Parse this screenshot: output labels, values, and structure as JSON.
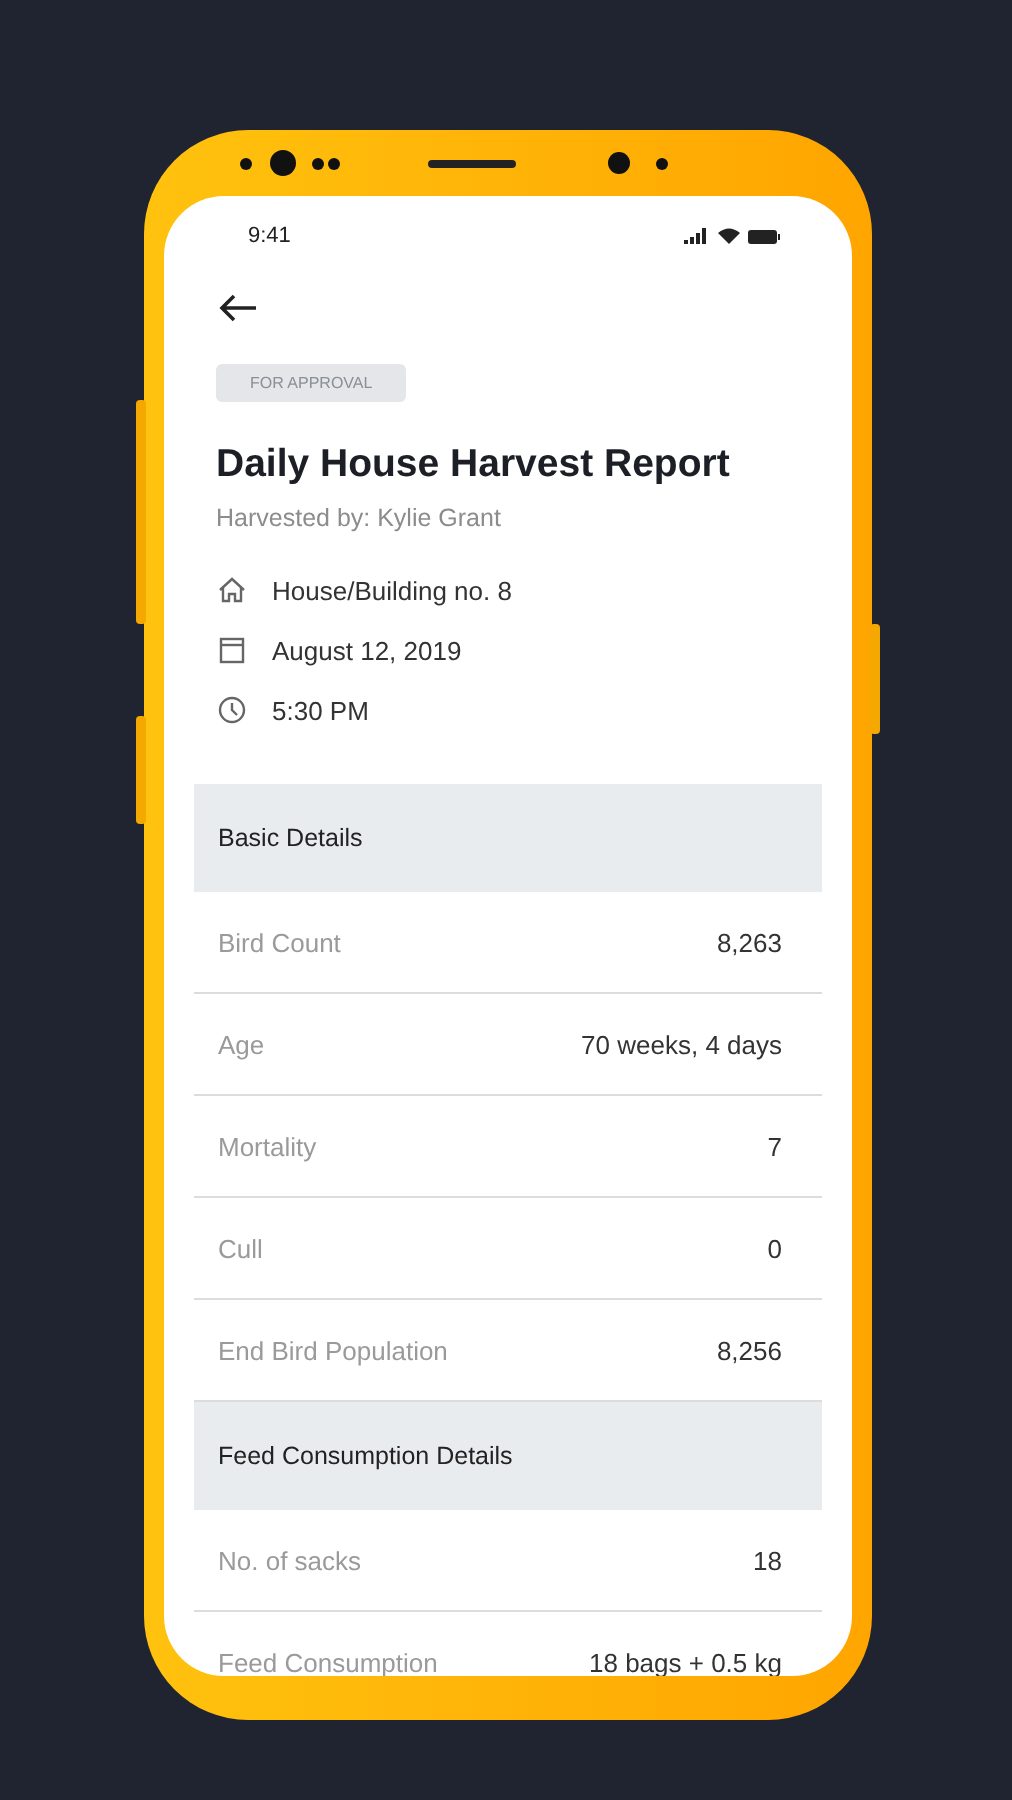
{
  "status_bar": {
    "time": "9:41"
  },
  "badge": "FOR APPROVAL",
  "title": "Daily House Harvest Report",
  "subtitle": "Harvested by: Kylie Grant",
  "info": [
    {
      "kind": "house",
      "text": "House/Building no. 8"
    },
    {
      "kind": "date",
      "text": "August 12, 2019"
    },
    {
      "kind": "time",
      "text": "5:30 PM"
    }
  ],
  "sections": [
    {
      "title": "Basic Details",
      "rows": [
        {
          "label": "Bird Count",
          "value": "8,263"
        },
        {
          "label": "Age",
          "value": "70 weeks, 4 days"
        },
        {
          "label": "Mortality",
          "value": "7"
        },
        {
          "label": "Cull",
          "value": "0"
        },
        {
          "label": "End Bird Population",
          "value": "8,256"
        }
      ]
    },
    {
      "title": "Feed Consumption Details",
      "rows": [
        {
          "label": "No. of sacks",
          "value": "18"
        },
        {
          "label": "Feed Consumption",
          "value": "18 bags + 0.5 kg"
        }
      ]
    }
  ]
}
